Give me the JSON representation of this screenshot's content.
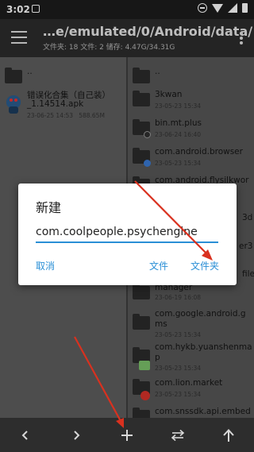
{
  "status_bar": {
    "time": "3:02"
  },
  "toolbar": {
    "path": "…e/emulated/0/Android/data/",
    "info": "文件夹: 18  文件: 2  储存: 4.47G/34.31G"
  },
  "left_pane": {
    "parent_label": "..",
    "file": {
      "name_line1": "错误化合集（自己装）",
      "name_line2": "_1.14514.apk",
      "date": "23-06-25 14:53",
      "size": "588.65M"
    }
  },
  "right_pane": {
    "parent_label": "..",
    "items": [
      {
        "name": "3kwan",
        "date": "23-05-23 15:34"
      },
      {
        "name": "bin.mt.plus",
        "date": "23-06-24 16:40"
      },
      {
        "name": "com.android.browser",
        "date": "23-05-23 15:34"
      },
      {
        "name": "com.android.flysilkwor",
        "date": ""
      },
      {
        "name": "manager",
        "date": "23-06-19 16:08"
      },
      {
        "name": "com.google.android.g",
        "name2": "ms",
        "date": "23-05-23 15:34"
      },
      {
        "name": "com.hykb.yuanshenma",
        "name2": "p",
        "date": "23-05-23 15:34"
      },
      {
        "name": "com.lion.market",
        "date": "23-05-23 15:34"
      },
      {
        "name": "com.snssdk.api.embed",
        "date": ""
      }
    ],
    "partial_right": [
      "3d",
      "er3",
      "file"
    ]
  },
  "dialog": {
    "title": "新建",
    "input_value": "com.coolpeople.psychengine",
    "cancel_label": "取消",
    "file_label": "文件",
    "folder_label": "文件夹"
  },
  "bottom_bar": {
    "back_icon": "chevron-left-icon",
    "forward_icon": "chevron-right-icon",
    "add_icon": "plus-icon",
    "swap_icon": "swap-arrows-icon",
    "up_icon": "arrow-up-icon"
  },
  "colors": {
    "accent": "#2a8fd6",
    "annotation_arrow": "#d9311f",
    "toolbar": "#2d2d2d"
  }
}
